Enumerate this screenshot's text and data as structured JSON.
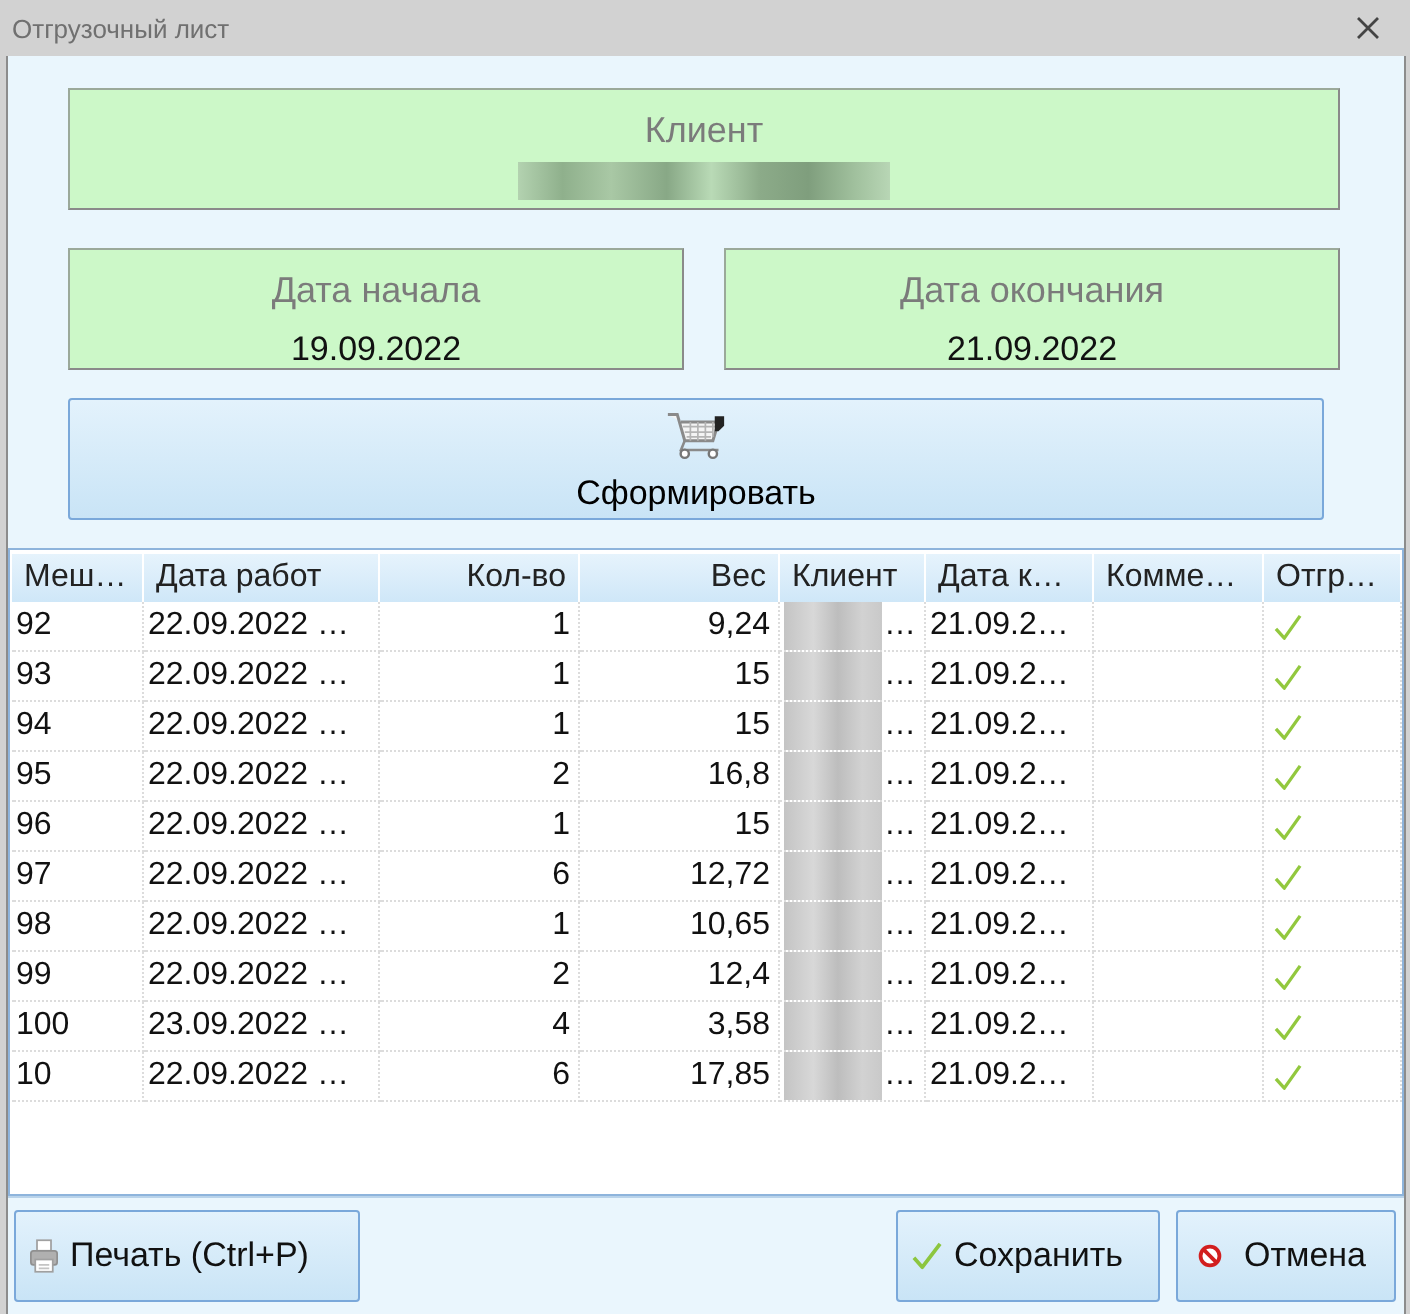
{
  "window": {
    "title": "Отгрузочный лист"
  },
  "client_field": {
    "label": "Клиент",
    "value_redacted": true
  },
  "date_fields": [
    {
      "label": "Дата начала",
      "value": "19.09.2022"
    },
    {
      "label": "Дата окончания",
      "value": "21.09.2022"
    }
  ],
  "form_button": {
    "label": "Сформировать"
  },
  "table": {
    "columns": [
      {
        "label": "Меш…",
        "kind": "text"
      },
      {
        "label": "Дата работ",
        "kind": "text"
      },
      {
        "label": "Кол-во",
        "kind": "number"
      },
      {
        "label": "Вес",
        "kind": "number"
      },
      {
        "label": "Клиент",
        "kind": "redacted"
      },
      {
        "label": "Дата к…",
        "kind": "text"
      },
      {
        "label": "Комме…",
        "kind": "text"
      },
      {
        "label": "Отгр…",
        "kind": "check"
      }
    ],
    "rows": [
      {
        "bag": "92",
        "work_date": "22.09.2022 …",
        "quantity": "1",
        "weight": "9,24",
        "client": {
          "redacted": true,
          "text": "…"
        },
        "end_date": "21.09.2…",
        "shipped": true
      },
      {
        "bag": "93",
        "work_date": "22.09.2022 …",
        "quantity": "1",
        "weight": "15",
        "client": {
          "redacted": true,
          "text": "…"
        },
        "end_date": "21.09.2…",
        "shipped": true
      },
      {
        "bag": "94",
        "work_date": "22.09.2022 …",
        "quantity": "1",
        "weight": "15",
        "client": {
          "redacted": true,
          "text": "…"
        },
        "end_date": "21.09.2…",
        "shipped": true
      },
      {
        "bag": "95",
        "work_date": "22.09.2022 …",
        "quantity": "2",
        "weight": "16,8",
        "client": {
          "redacted": true,
          "text": "…"
        },
        "end_date": "21.09.2…",
        "shipped": true
      },
      {
        "bag": "96",
        "work_date": "22.09.2022 …",
        "quantity": "1",
        "weight": "15",
        "client": {
          "redacted": true,
          "text": "…"
        },
        "end_date": "21.09.2…",
        "shipped": true
      },
      {
        "bag": "97",
        "work_date": "22.09.2022 …",
        "quantity": "6",
        "weight": "12,72",
        "client": {
          "redacted": true,
          "text": "…"
        },
        "end_date": "21.09.2…",
        "shipped": true
      },
      {
        "bag": "98",
        "work_date": "22.09.2022 …",
        "quantity": "1",
        "weight": "10,65",
        "client": {
          "redacted": true,
          "text": "…"
        },
        "end_date": "21.09.2…",
        "shipped": true
      },
      {
        "bag": "99",
        "work_date": "22.09.2022 …",
        "quantity": "2",
        "weight": "12,4",
        "client": {
          "redacted": true,
          "text": "…"
        },
        "end_date": "21.09.2…",
        "shipped": true
      },
      {
        "bag": "100",
        "work_date": "23.09.2022 …",
        "quantity": "4",
        "weight": "3,58",
        "client": {
          "redacted": true,
          "text": "…"
        },
        "end_date": "21.09.2…",
        "shipped": true
      },
      {
        "bag": "10",
        "work_date": "22.09.2022 …",
        "quantity": "6",
        "weight": "17,85",
        "client": {
          "redacted": true,
          "text": "…"
        },
        "end_date": "21.09.2…",
        "shipped": true
      }
    ]
  },
  "footer": {
    "left": [
      {
        "kind": "print",
        "label": "Печать (Ctrl+P)"
      }
    ],
    "right": [
      {
        "kind": "save",
        "label": "Сохранить"
      },
      {
        "kind": "cancel",
        "label": "Отмена"
      }
    ]
  }
}
